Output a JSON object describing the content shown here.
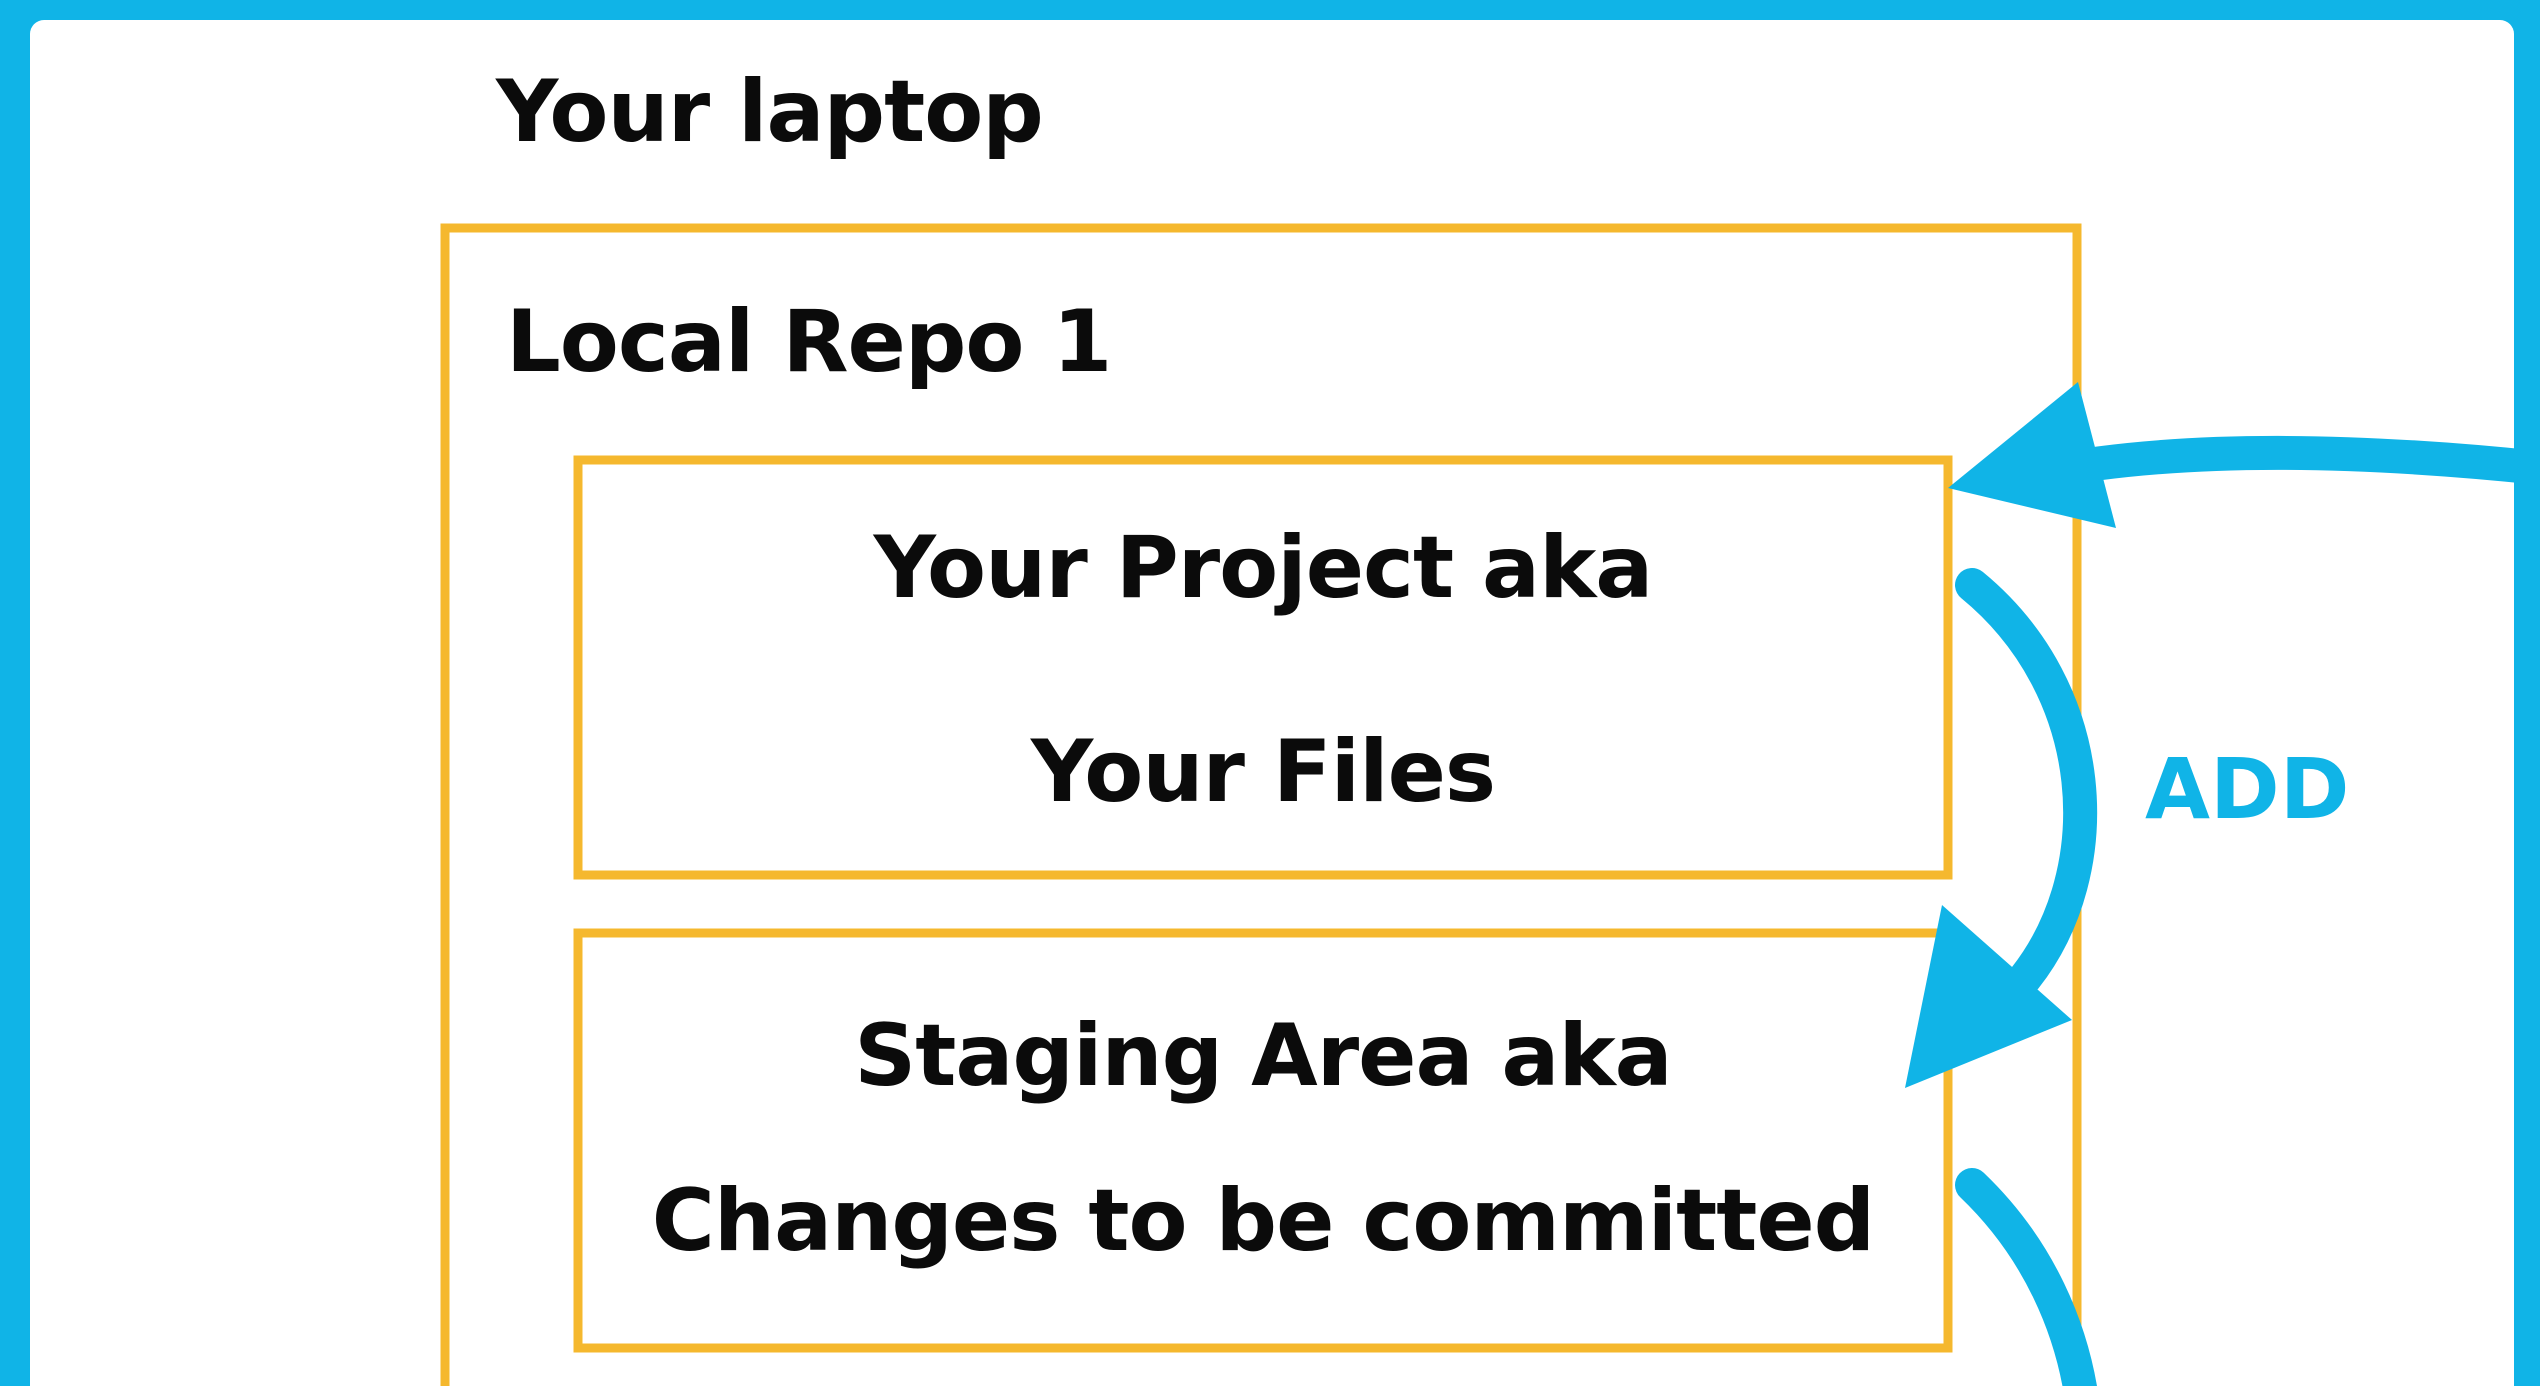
{
  "laptop": {
    "title": "Your laptop"
  },
  "repo": {
    "title": "Local Repo 1"
  },
  "project_box": {
    "line1": "Your Project aka",
    "line2": "Your Files"
  },
  "staging_box": {
    "line1": "Staging Area aka",
    "line2": "Changes to be committed"
  },
  "arrows": {
    "add_label": "ADD"
  },
  "colors": {
    "frame": "#10b4e7",
    "box_border": "#f5b82e",
    "arrow": "#10b4e7",
    "text": "#0b0b0b",
    "background": "#ffffff"
  }
}
